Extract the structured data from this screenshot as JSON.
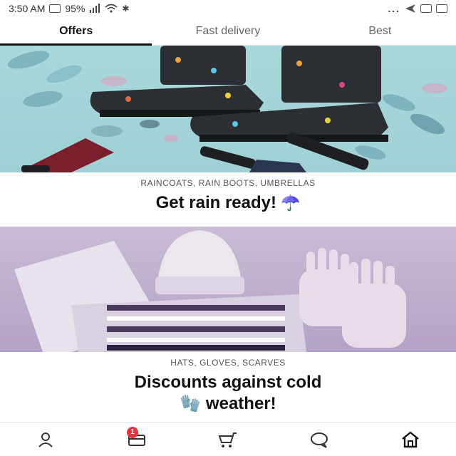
{
  "status_bar": {
    "time": "3:50 AM",
    "battery": "95%",
    "dots": "..."
  },
  "tabs": [
    {
      "label": "Offers",
      "active": true
    },
    {
      "label": "Fast delivery",
      "active": false
    },
    {
      "label": "Best",
      "active": false
    }
  ],
  "offers": [
    {
      "subtitle": "RAINCOATS, RAIN BOOTS, UMBRELLAS",
      "title": "Get rain ready!",
      "emoji": "☂️",
      "image": "rain boots and umbrellas"
    },
    {
      "subtitle": "HATS, GLOVES, SCARVES",
      "title_line1": "Discounts against cold",
      "title_line2": "weather!",
      "emoji": "🧤",
      "image": "knit hat, scarf and gloves"
    }
  ],
  "bottom_nav": {
    "items": [
      {
        "name": "home-icon"
      },
      {
        "name": "chat-icon"
      },
      {
        "name": "cart-icon"
      },
      {
        "name": "wallet-icon",
        "badge": "1"
      },
      {
        "name": "profile-icon"
      }
    ]
  },
  "colors": {
    "badge": "#e8323c",
    "rain_bg": "#a9d8dc",
    "cold_bg": "#c9bcd6"
  }
}
